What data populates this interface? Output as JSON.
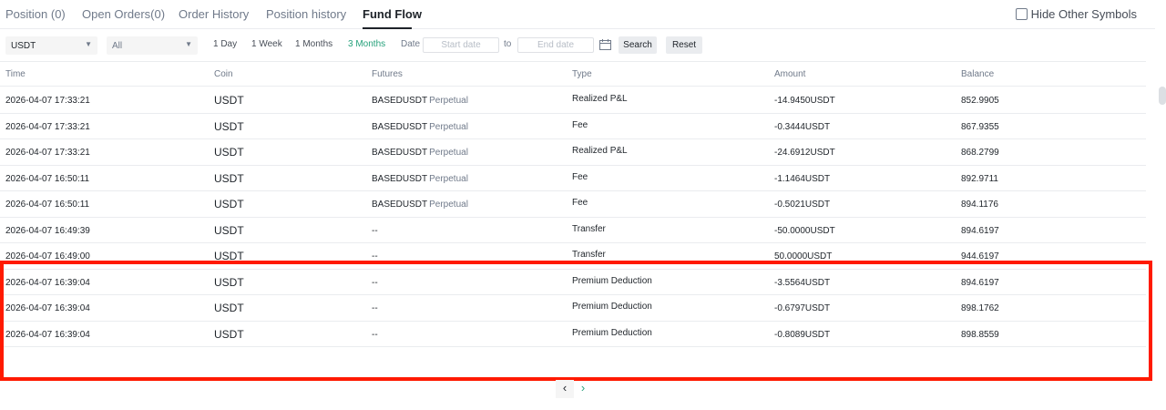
{
  "tabs": [
    {
      "label": "Position (0)"
    },
    {
      "label": "Open Orders(0)"
    },
    {
      "label": "Order History"
    },
    {
      "label": "Position history"
    },
    {
      "label": "Fund Flow"
    }
  ],
  "active_tab": "Fund Flow",
  "hide_other_symbols": {
    "label": "Hide Other Symbols",
    "checked": false
  },
  "filters": {
    "coin_select": "USDT",
    "type_select": "All",
    "periods": [
      "1 Day",
      "1 Week",
      "1 Months",
      "3 Months"
    ],
    "active_period": "3 Months",
    "date_label": "Date",
    "start_placeholder": "Start date",
    "to_label": "to",
    "end_placeholder": "End date",
    "search_label": "Search",
    "reset_label": "Reset"
  },
  "table": {
    "headers": [
      "Time",
      "Coin",
      "Futures",
      "Type",
      "Amount",
      "Balance"
    ],
    "rows": [
      {
        "time": "2026-04-07 17:33:21",
        "coin": "USDT",
        "futures_symbol": "BASEDUSDT",
        "futures_kind": "Perpetual",
        "type": "Realized P&L",
        "amount": "-14.9450USDT",
        "balance": "852.9905"
      },
      {
        "time": "2026-04-07 17:33:21",
        "coin": "USDT",
        "futures_symbol": "BASEDUSDT",
        "futures_kind": "Perpetual",
        "type": "Fee",
        "amount": "-0.3444USDT",
        "balance": "867.9355"
      },
      {
        "time": "2026-04-07 17:33:21",
        "coin": "USDT",
        "futures_symbol": "BASEDUSDT",
        "futures_kind": "Perpetual",
        "type": "Realized P&L",
        "amount": "-24.6912USDT",
        "balance": "868.2799"
      },
      {
        "time": "2026-04-07 16:50:11",
        "coin": "USDT",
        "futures_symbol": "BASEDUSDT",
        "futures_kind": "Perpetual",
        "type": "Fee",
        "amount": "-1.1464USDT",
        "balance": "892.9711"
      },
      {
        "time": "2026-04-07 16:50:11",
        "coin": "USDT",
        "futures_symbol": "BASEDUSDT",
        "futures_kind": "Perpetual",
        "type": "Fee",
        "amount": "-0.5021USDT",
        "balance": "894.1176"
      },
      {
        "time": "2026-04-07 16:49:39",
        "coin": "USDT",
        "futures_symbol": "--",
        "futures_kind": "",
        "type": "Transfer",
        "amount": "-50.0000USDT",
        "balance": "894.6197"
      },
      {
        "time": "2026-04-07 16:49:00",
        "coin": "USDT",
        "futures_symbol": "--",
        "futures_kind": "",
        "type": "Transfer",
        "amount": "50.0000USDT",
        "balance": "944.6197"
      },
      {
        "time": "2026-04-07 16:39:04",
        "coin": "USDT",
        "futures_symbol": "--",
        "futures_kind": "",
        "type": "Premium Deduction",
        "amount": "-3.5564USDT",
        "balance": "894.6197"
      },
      {
        "time": "2026-04-07 16:39:04",
        "coin": "USDT",
        "futures_symbol": "--",
        "futures_kind": "",
        "type": "Premium Deduction",
        "amount": "-0.6797USDT",
        "balance": "898.1762"
      },
      {
        "time": "2026-04-07 16:39:04",
        "coin": "USDT",
        "futures_symbol": "--",
        "futures_kind": "",
        "type": "Premium Deduction",
        "amount": "-0.8089USDT",
        "balance": "898.8559"
      }
    ]
  },
  "pagination": {
    "prev": "‹",
    "next": "›"
  },
  "colors": {
    "accent": "#26a17b",
    "highlight": "#ff1a00",
    "text": "#1e2329",
    "muted": "#707a8a"
  }
}
